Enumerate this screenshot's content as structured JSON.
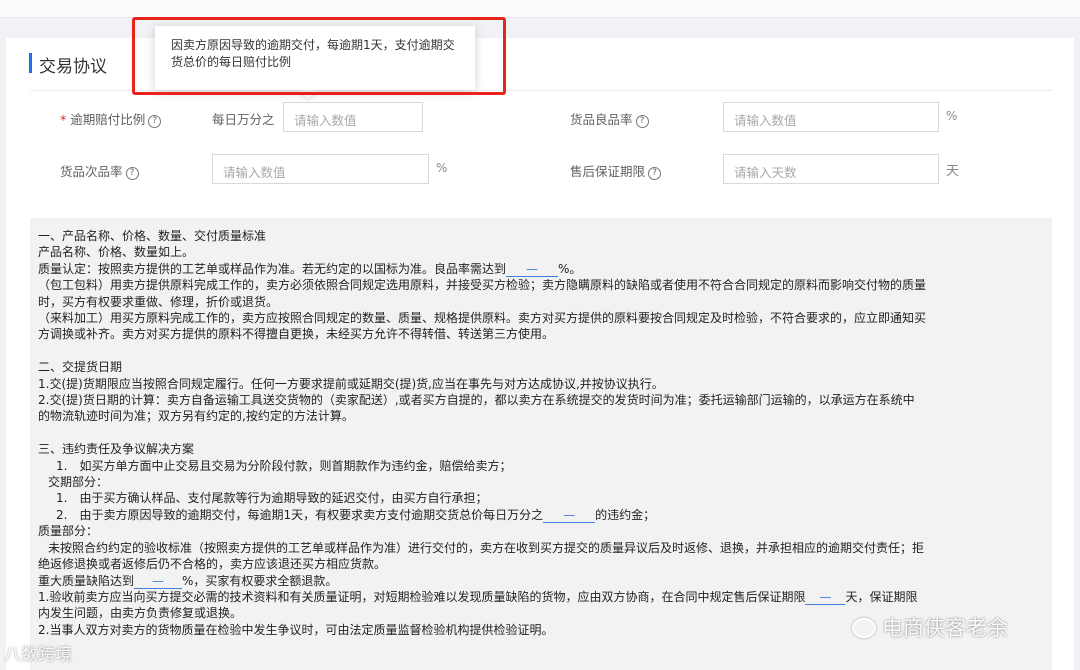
{
  "section": {
    "title": "交易协议"
  },
  "tooltip": {
    "text": "因卖方原因导致的逾期交付，每逾期1天，支付逾期交货总价的每日赔付比例"
  },
  "form": {
    "overdue": {
      "required_mark": "*",
      "label": "逾期赔付比例",
      "prefix": "每日万分之",
      "placeholder": "请输入数值"
    },
    "good_rate": {
      "label": "货品良品率",
      "placeholder": "请输入数值",
      "unit": "%"
    },
    "defect_rate": {
      "label": "货品次品率",
      "placeholder": "请输入数值",
      "unit": "%"
    },
    "warranty": {
      "label": "售后保证期限",
      "placeholder": "请输入天数",
      "unit": "天"
    }
  },
  "contract": {
    "s1_title": "一、产品名称、价格、数量、交付质量标准",
    "s1_l1": "产品名称、价格、数量如上。",
    "s1_l2_pre": "质量认定：按照卖方提供的工艺单或样品作为准。若无约定的以国标为准。良品率需达到",
    "s1_l2_blank": "—",
    "s1_l2_post": "%。",
    "s1_l3": "（包工包料）用卖方提供原料完成工作的，卖方必须依照合同规定选用原料，并接受买方检验；卖方隐瞒原料的缺陷或者使用不符合合同规定的原料而影响交付物的质量",
    "s1_l4": "时，买方有权要求重做、修理，折价或退货。",
    "s1_l5": "（来料加工）用买方原料完成工作的，卖方应按照合同规定的数量、质量、规格提供原料。卖方对买方提供的原料要按合同规定及时检验，不符合要求的，应立即通知买",
    "s1_l6": "方调换或补齐。卖方对买方提供的原料不得擅自更换，未经买方允许不得转借、转送第三方使用。",
    "s2_title": "二、交提货日期",
    "s2_l1": "1.交(提)货期限应当按照合同规定履行。任何一方要求提前或延期交(提)货,应当在事先与对方达成协议,并按协议执行。",
    "s2_l2": "2.交(提)货日期的计算：卖方自备运输工具送交货物的（卖家配送）,或者买方自提的，都以卖方在系统提交的发货时间为准；委托运输部门运输的，以承运方在系统中",
    "s2_l3": "的物流轨迹时间为准；双方另有约定的,按约定的方法计算。",
    "s3_title": "三、违约责任及争议解决方案",
    "s3_l1": "1.　如买方单方面中止交易且交易为分阶段付款，则首期款作为违约金，赔偿给卖方；",
    "s3_l2": "交期部分：",
    "s3_l3": "1.　由于买方确认样品、支付尾款等行为逾期导致的延迟交付，由买方自行承担；",
    "s3_l4_pre": "2.　由于卖方原因导致的逾期交付，每逾期1天，有权要求卖方支付逾期交货总价每日万分之",
    "s3_l4_blank": "—",
    "s3_l4_post": "的违约金；",
    "s3_l5": "质量部分：",
    "s3_l6": "未按照合约约定的验收标准（按照卖方提供的工艺单或样品作为准）进行交付的，卖方在收到买方提交的质量异议后及时返修、退换，并承担相应的逾期交付责任；拒",
    "s3_l7": "绝返修退换或者返修后仍不合格的，卖方应该退还买方相应货款。",
    "s3_l8_pre": "重大质量缺陷达到",
    "s3_l8_blank": "—",
    "s3_l8_post": "%，买家有权要求全额退款。",
    "s3_l9_pre": "1.验收前卖方应当向买方提交必需的技术资料和有关质量证明，对短期检验难以发现质量缺陷的货物，应由双方协商，在合同中规定售后保证期限",
    "s3_l9_blank": "—",
    "s3_l9_post": "天，保证期限",
    "s3_l10": "内发生问题，由卖方负责修复或退换。",
    "s3_l11": "2.当事人双方对卖方的货物质量在检验中发生争议时，可由法定质量监督检验机构提供检验证明。"
  },
  "watermark": {
    "left": "八数跨境",
    "right": "电商侠客老余"
  },
  "colors": {
    "accent": "#1f6feb",
    "highlight": "#e8231d",
    "required": "#e02424"
  }
}
